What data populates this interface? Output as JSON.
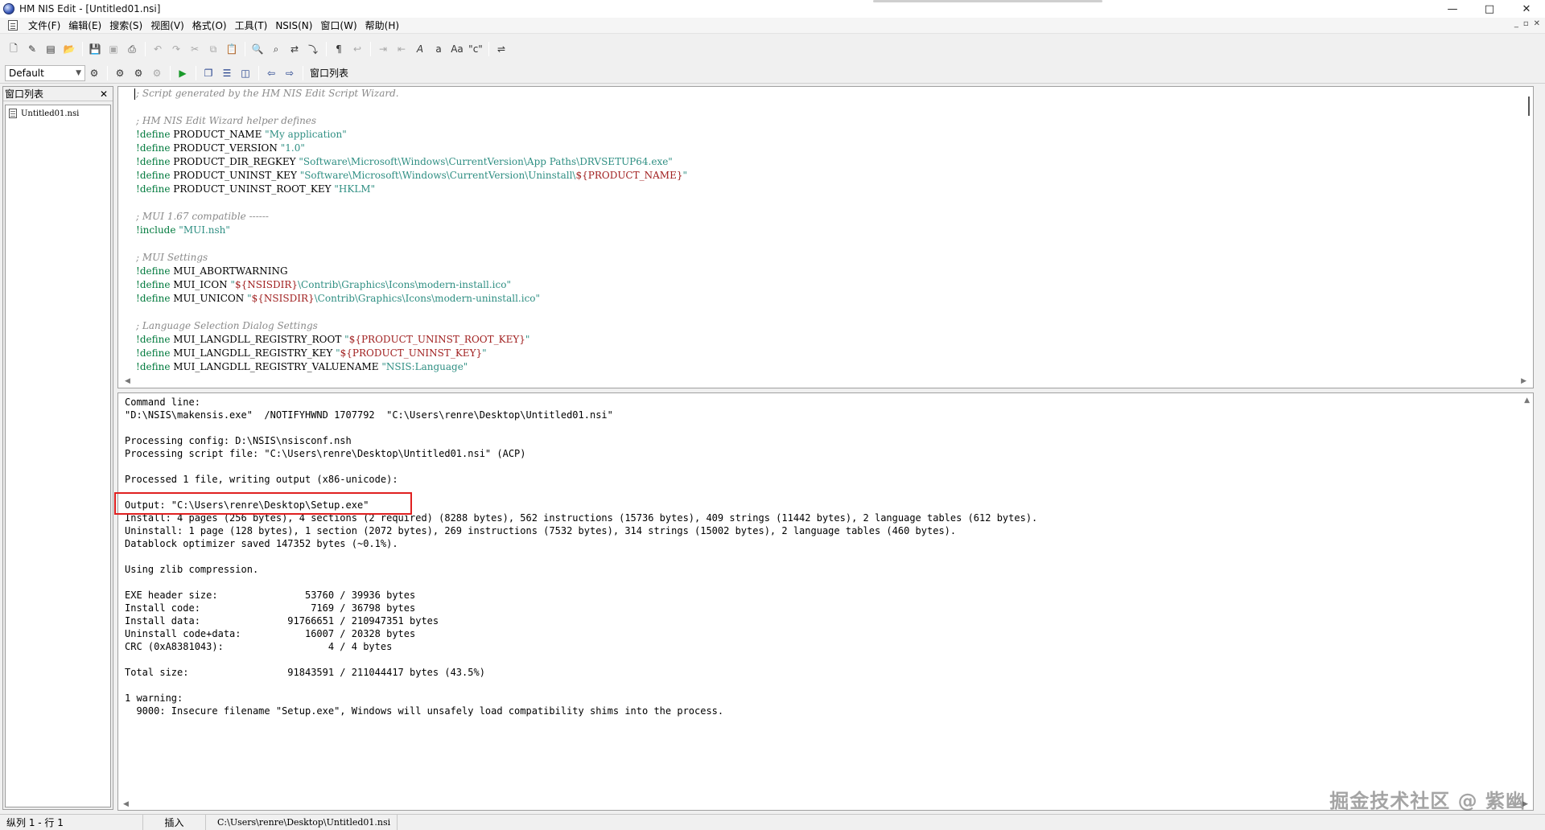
{
  "window": {
    "title": "HM NIS Edit - [Untitled01.nsi]",
    "controls": {
      "minimize": "—",
      "maximize": "□",
      "close": "✕"
    }
  },
  "menu": {
    "items": [
      "文件(F)",
      "编辑(E)",
      "搜索(S)",
      "视图(V)",
      "格式(O)",
      "工具(T)",
      "NSIS(N)",
      "窗口(W)",
      "帮助(H)"
    ],
    "mdi_controls": [
      "_",
      "▫",
      "✕"
    ]
  },
  "toolbar2": {
    "style_value": "Default",
    "window_list_label": "窗口列表"
  },
  "window_list": {
    "title": "窗口列表",
    "close": "✕",
    "files": [
      "Untitled01.nsi"
    ]
  },
  "editor": {
    "lines": [
      [
        {
          "t": "; Script generated by the HM NIS Edit Script Wizard.",
          "c": "cmt"
        }
      ],
      [],
      [
        {
          "t": "; HM NIS Edit Wizard helper defines",
          "c": "cmt"
        }
      ],
      [
        {
          "t": "!define",
          "c": "kw"
        },
        {
          "t": " PRODUCT_NAME ",
          "c": ""
        },
        {
          "t": "\"My application\"",
          "c": "str"
        }
      ],
      [
        {
          "t": "!define",
          "c": "kw"
        },
        {
          "t": " PRODUCT_VERSION ",
          "c": ""
        },
        {
          "t": "\"1.0\"",
          "c": "str"
        }
      ],
      [
        {
          "t": "!define",
          "c": "kw"
        },
        {
          "t": " PRODUCT_DIR_REGKEY ",
          "c": ""
        },
        {
          "t": "\"Software\\Microsoft\\Windows\\CurrentVersion\\App Paths\\DRVSETUP64.exe\"",
          "c": "str"
        }
      ],
      [
        {
          "t": "!define",
          "c": "kw"
        },
        {
          "t": " PRODUCT_UNINST_KEY ",
          "c": ""
        },
        {
          "t": "\"Software\\Microsoft\\Windows\\CurrentVersion\\Uninstall\\",
          "c": "str"
        },
        {
          "t": "${PRODUCT_NAME}",
          "c": "var"
        },
        {
          "t": "\"",
          "c": "str"
        }
      ],
      [
        {
          "t": "!define",
          "c": "kw"
        },
        {
          "t": " PRODUCT_UNINST_ROOT_KEY ",
          "c": ""
        },
        {
          "t": "\"HKLM\"",
          "c": "str"
        }
      ],
      [],
      [
        {
          "t": "; MUI 1.67 compatible ------",
          "c": "cmt"
        }
      ],
      [
        {
          "t": "!include",
          "c": "kw"
        },
        {
          "t": " ",
          "c": ""
        },
        {
          "t": "\"MUI.nsh\"",
          "c": "str"
        }
      ],
      [],
      [
        {
          "t": "; MUI Settings",
          "c": "cmt"
        }
      ],
      [
        {
          "t": "!define",
          "c": "kw"
        },
        {
          "t": " MUI_ABORTWARNING",
          "c": ""
        }
      ],
      [
        {
          "t": "!define",
          "c": "kw"
        },
        {
          "t": " MUI_ICON ",
          "c": ""
        },
        {
          "t": "\"",
          "c": "str"
        },
        {
          "t": "${NSISDIR}",
          "c": "var"
        },
        {
          "t": "\\Contrib\\Graphics\\Icons\\modern-install.ico\"",
          "c": "str"
        }
      ],
      [
        {
          "t": "!define",
          "c": "kw"
        },
        {
          "t": " MUI_UNICON ",
          "c": ""
        },
        {
          "t": "\"",
          "c": "str"
        },
        {
          "t": "${NSISDIR}",
          "c": "var"
        },
        {
          "t": "\\Contrib\\Graphics\\Icons\\modern-uninstall.ico\"",
          "c": "str"
        }
      ],
      [],
      [
        {
          "t": "; Language Selection Dialog Settings",
          "c": "cmt"
        }
      ],
      [
        {
          "t": "!define",
          "c": "kw"
        },
        {
          "t": " MUI_LANGDLL_REGISTRY_ROOT ",
          "c": ""
        },
        {
          "t": "\"",
          "c": "str"
        },
        {
          "t": "${PRODUCT_UNINST_ROOT_KEY}",
          "c": "var"
        },
        {
          "t": "\"",
          "c": "str"
        }
      ],
      [
        {
          "t": "!define",
          "c": "kw"
        },
        {
          "t": " MUI_LANGDLL_REGISTRY_KEY ",
          "c": ""
        },
        {
          "t": "\"",
          "c": "str"
        },
        {
          "t": "${PRODUCT_UNINST_KEY}",
          "c": "var"
        },
        {
          "t": "\"",
          "c": "str"
        }
      ],
      [
        {
          "t": "!define",
          "c": "kw"
        },
        {
          "t": " MUI_LANGDLL_REGISTRY_VALUENAME ",
          "c": ""
        },
        {
          "t": "\"NSIS:Language\"",
          "c": "str"
        }
      ]
    ]
  },
  "output": {
    "lines": [
      "Command line:",
      "\"D:\\NSIS\\makensis.exe\"  /NOTIFYHWND 1707792  \"C:\\Users\\renre\\Desktop\\Untitled01.nsi\"",
      "",
      "Processing config: D:\\NSIS\\nsisconf.nsh",
      "Processing script file: \"C:\\Users\\renre\\Desktop\\Untitled01.nsi\" (ACP)",
      "",
      "Processed 1 file, writing output (x86-unicode):",
      "",
      "Output: \"C:\\Users\\renre\\Desktop\\Setup.exe\"",
      "Install: 4 pages (256 bytes), 4 sections (2 required) (8288 bytes), 562 instructions (15736 bytes), 409 strings (11442 bytes), 2 language tables (612 bytes).",
      "Uninstall: 1 page (128 bytes), 1 section (2072 bytes), 269 instructions (7532 bytes), 314 strings (15002 bytes), 2 language tables (460 bytes).",
      "Datablock optimizer saved 147352 bytes (~0.1%).",
      "",
      "Using zlib compression.",
      "",
      "EXE header size:               53760 / 39936 bytes",
      "Install code:                   7169 / 36798 bytes",
      "Install data:               91766651 / 210947351 bytes",
      "Uninstall code+data:           16007 / 20328 bytes",
      "CRC (0xA8381043):                  4 / 4 bytes",
      "",
      "Total size:                 91843591 / 211044417 bytes (43.5%)",
      "",
      "1 warning:",
      "  9000: Insecure filename \"Setup.exe\", Windows will unsafely load compatibility shims into the process."
    ]
  },
  "statusbar": {
    "position": "纵列 1 - 行 1",
    "mode": "插入",
    "path": "C:\\Users\\renre\\Desktop\\Untitled01.nsi"
  },
  "watermark": "掘金技术社区 @ 紫幽",
  "colors": {
    "comment": "#8a8a8a",
    "keyword": "#007a3d",
    "string": "#2f8f83",
    "variable": "#a01f1f",
    "highlight_box": "#e02020"
  }
}
